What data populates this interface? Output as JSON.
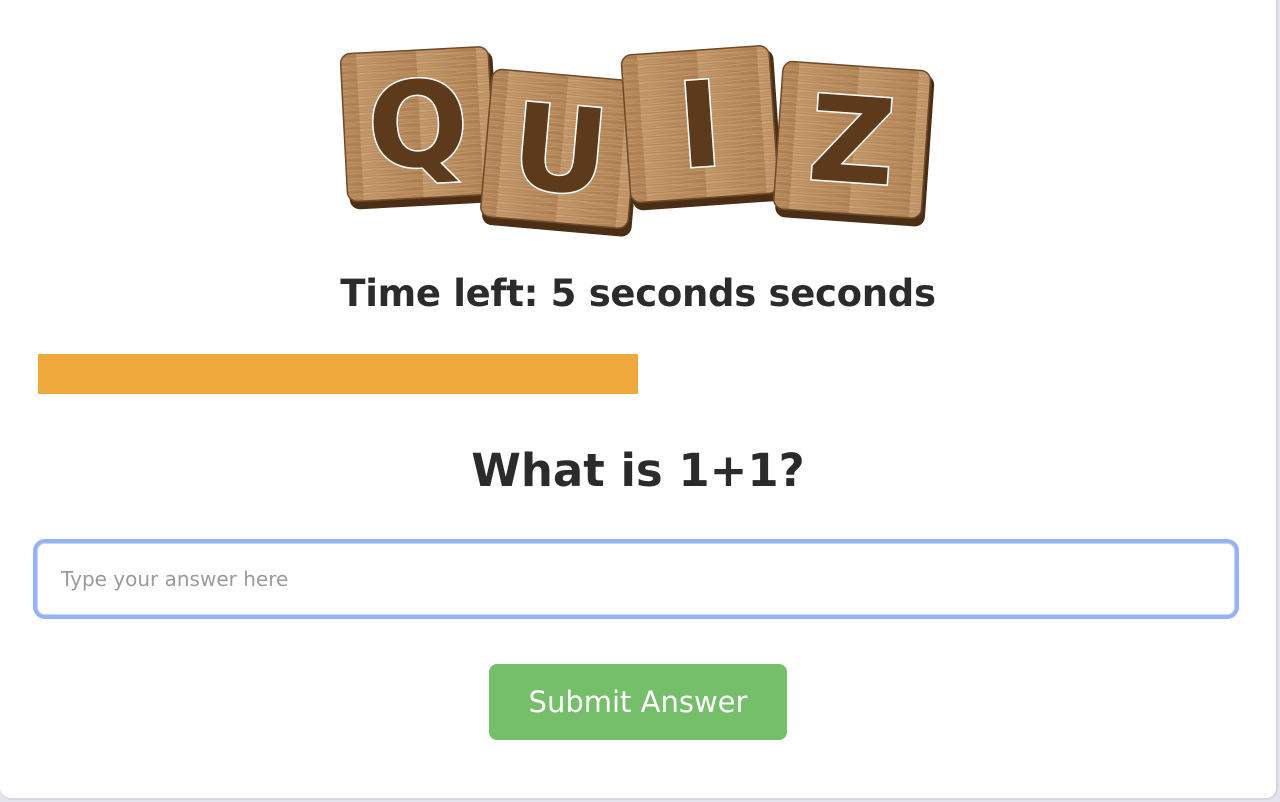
{
  "logo": {
    "letters": [
      "Q",
      "U",
      "I",
      "Z"
    ],
    "tile_color": "#b88a5c",
    "letter_color": "#5e3a1c"
  },
  "timer": {
    "text": "Time left: 5 seconds seconds"
  },
  "progress": {
    "fraction_remaining": 0.5,
    "color": "#efa83c"
  },
  "question": {
    "text": "What is 1+1?"
  },
  "answer": {
    "value": "",
    "placeholder": "Type your answer here"
  },
  "submit": {
    "label": "Submit Answer",
    "color": "#76bf6a"
  }
}
